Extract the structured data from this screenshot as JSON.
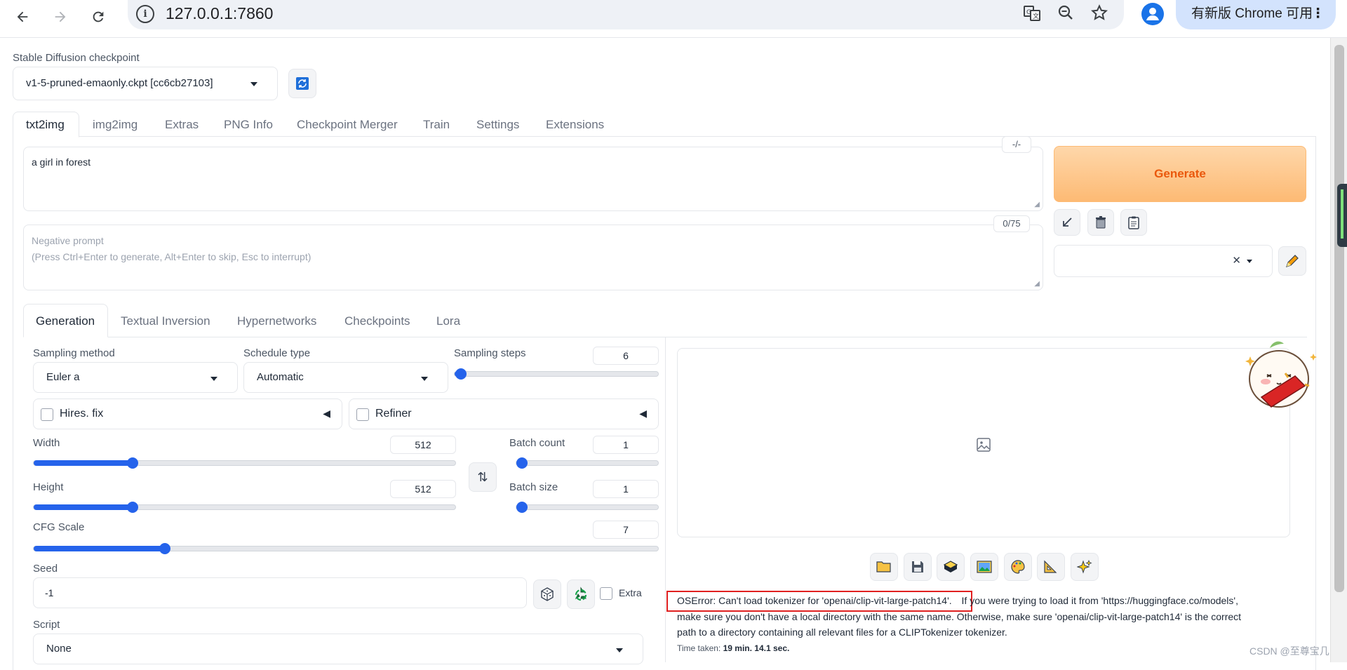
{
  "browser": {
    "url": "127.0.0.1:7860",
    "update_label": "有新版 Chrome 可用"
  },
  "checkpoint": {
    "label": "Stable Diffusion checkpoint",
    "value": "v1-5-pruned-emaonly.ckpt [cc6cb27103]"
  },
  "main_tabs": [
    "txt2img",
    "img2img",
    "Extras",
    "PNG Info",
    "Checkpoint Merger",
    "Train",
    "Settings",
    "Extensions"
  ],
  "prompt": {
    "value": "a girl in forest",
    "counter": "-/-"
  },
  "negative_prompt": {
    "placeholder_line1": "Negative prompt",
    "placeholder_line2": "(Press Ctrl+Enter to generate, Alt+Enter to skip, Esc to interrupt)",
    "counter": "0/75"
  },
  "generate_label": "Generate",
  "sub_tabs": [
    "Generation",
    "Textual Inversion",
    "Hypernetworks",
    "Checkpoints",
    "Lora"
  ],
  "sampling": {
    "method_label": "Sampling method",
    "method_value": "Euler a",
    "schedule_label": "Schedule type",
    "schedule_value": "Automatic",
    "steps_label": "Sampling steps",
    "steps_value": "6",
    "steps_fraction": 0.03
  },
  "hires_label": "Hires. fix",
  "refiner_label": "Refiner",
  "width": {
    "label": "Width",
    "value": "512",
    "fraction": 0.235
  },
  "height": {
    "label": "Height",
    "value": "512",
    "fraction": 0.235
  },
  "batch_count": {
    "label": "Batch count",
    "value": "1",
    "fraction": 0.0
  },
  "batch_size": {
    "label": "Batch size",
    "value": "1",
    "fraction": 0.0
  },
  "cfg": {
    "label": "CFG Scale",
    "value": "7",
    "fraction": 0.21
  },
  "seed": {
    "label": "Seed",
    "value": "-1",
    "extra_label": "Extra"
  },
  "script": {
    "label": "Script",
    "value": "None"
  },
  "error": {
    "highlight": "OSError: Can't load tokenizer for 'openai/clip-vit-large-patch14'.",
    "rest_line1": " If you were trying to load it from 'https://huggingface.co/models',",
    "line2": "make sure you don't have a local directory with the same name. Otherwise, make sure 'openai/clip-vit-large-patch14' is the correct",
    "line3": "path to a directory containing all relevant files for a CLIPTokenizer tokenizer.",
    "time_label": "Time taken:",
    "time_value": "19 min. 14.1 sec."
  },
  "watermark": "CSDN @至尊宝几",
  "colors": {
    "accent": "#2563eb",
    "generate_text": "#ea580c",
    "error_border": "#e02020"
  }
}
